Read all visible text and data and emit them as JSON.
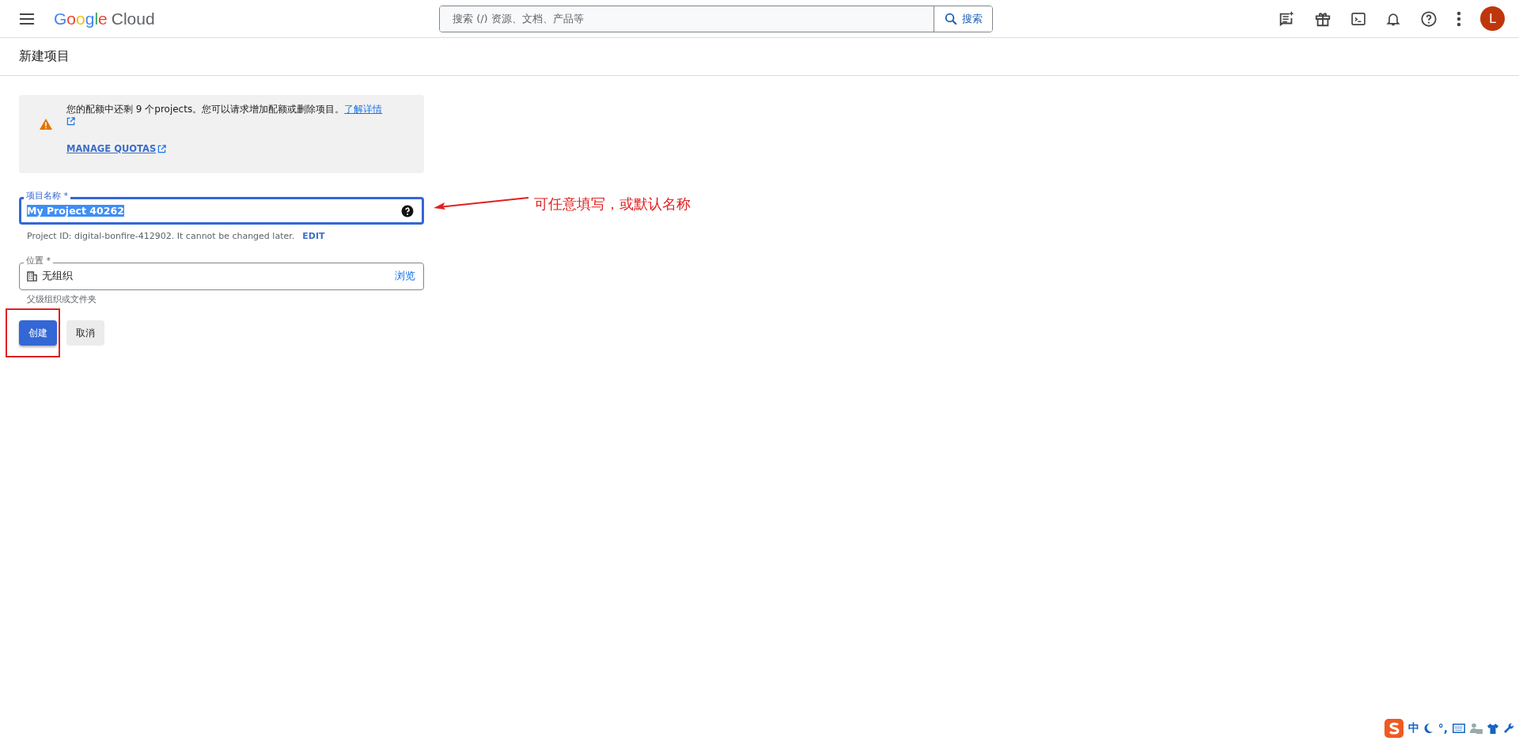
{
  "header": {
    "logo_word": "Google",
    "logo_suffix": "Cloud",
    "search": {
      "placeholder": "搜索 (/) 资源、文档、产品等",
      "button": "搜索"
    },
    "avatar": "L"
  },
  "page_title": "新建项目",
  "notice": {
    "text": "您的配额中还剩 9 个projects。您可以请求增加配额或删除项目。",
    "link": "了解详情",
    "action": "MANAGE QUOTAS"
  },
  "name_field": {
    "label": "项目名称 *",
    "value": "My Project 40262",
    "focused": true
  },
  "project_id": {
    "text": "Project ID: digital-bonfire-412902. It cannot be changed later.",
    "action": "EDIT"
  },
  "location_field": {
    "label": "位置 *",
    "value": "无组织",
    "action": "浏览",
    "hint": "父级组织或文件夹"
  },
  "buttons": [
    {
      "label": "创建",
      "kind": "primary"
    },
    {
      "label": "取消",
      "kind": "secondary"
    }
  ],
  "annotation": "可任意填写，或默认名称",
  "ime_bar": {
    "mode": "中",
    "punct": "°,"
  }
}
